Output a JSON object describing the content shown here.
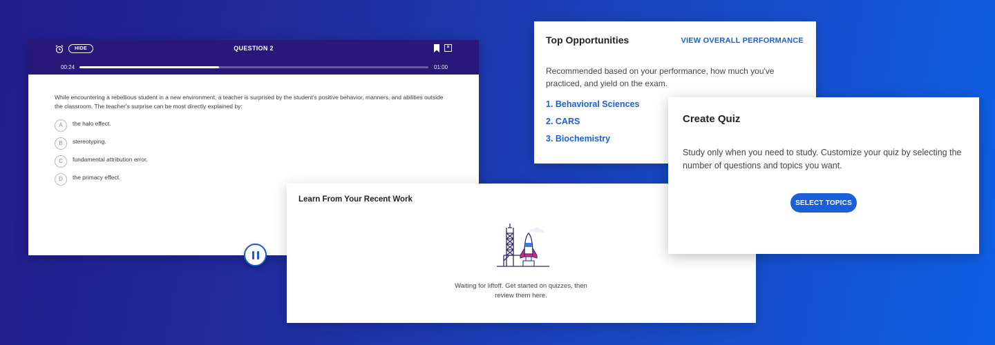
{
  "colors": {
    "header_bg": "#291879",
    "accent_blue": "#1a5ed8",
    "rocket_pink": "#e0267a",
    "rocket_blue": "#3d78e3"
  },
  "question_panel": {
    "hide_label": "HIDE",
    "title": "QUESTION 2",
    "time_elapsed": "00:24",
    "time_total": "01:00",
    "progress_fraction": 0.4,
    "question_text": "While encountering a rebellious student in a new environment, a teacher is surprised by the student's positive behavior, manners, and abilities outside the classroom. The teacher's surprise can be most directly explained by:",
    "choices": [
      {
        "letter": "A",
        "text": "the halo effect."
      },
      {
        "letter": "B",
        "text": "stereotyping."
      },
      {
        "letter": "C",
        "text": "fundamental attribution error."
      },
      {
        "letter": "D",
        "text": "the primacy effect."
      }
    ],
    "icons": {
      "timer": "alarm-clock-icon",
      "bookmark": "bookmark-icon",
      "close": "close-icon",
      "pause": "pause-icon"
    }
  },
  "top_opportunities": {
    "title": "Top Opportunities",
    "link": "VIEW OVERALL PERFORMANCE",
    "description": "Recommended based on your performance, how much you've practiced, and yield on the exam.",
    "items": [
      "1. Behavioral Sciences",
      "2. CARS",
      "3. Biochemistry"
    ]
  },
  "recent_work": {
    "title": "Learn From Your Recent Work",
    "empty_message": "Waiting for liftoff. Get started on quizzes, then review them here.",
    "illustration": "rocket-launch-illustration"
  },
  "create_quiz": {
    "title": "Create Quiz",
    "description": "Study only when you need to study. Customize your quiz by selecting the number of questions and topics you want.",
    "button_label": "SELECT TOPICS"
  }
}
